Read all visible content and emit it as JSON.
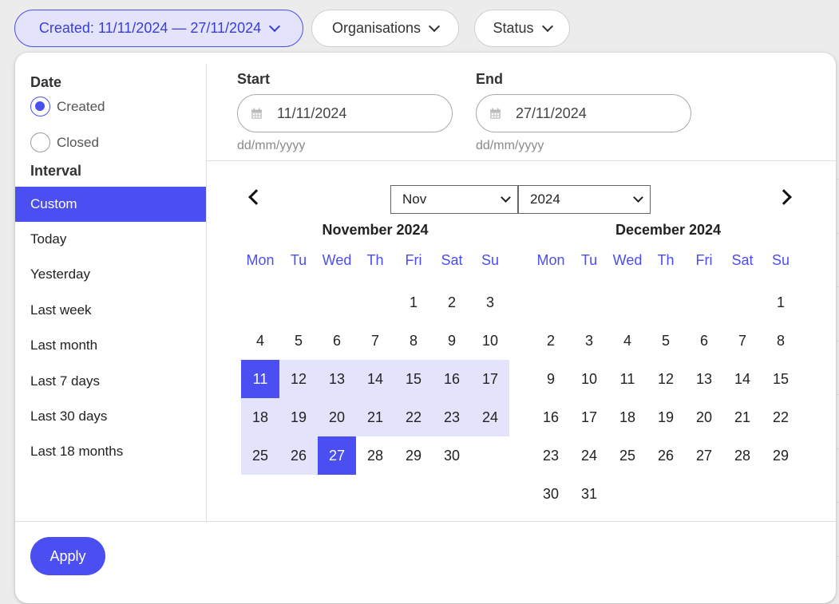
{
  "filters": {
    "created_chip": "Created: 11/11/2024 — 27/11/2024",
    "organisations_chip": "Organisations",
    "status_chip": "Status"
  },
  "date_type": {
    "heading": "Date",
    "options": [
      "Created",
      "Closed"
    ],
    "selected": "Created"
  },
  "interval": {
    "heading": "Interval",
    "items": [
      "Custom",
      "Today",
      "Yesterday",
      "Last week",
      "Last month",
      "Last 7 days",
      "Last 30 days",
      "Last 18 months"
    ],
    "selected": "Custom"
  },
  "start": {
    "label": "Start",
    "value": "11/11/2024",
    "hint": "dd/mm/yyyy"
  },
  "end": {
    "label": "End",
    "value": "27/11/2024",
    "hint": "dd/mm/yyyy"
  },
  "nav": {
    "month_select": "Nov",
    "year_select": "2024"
  },
  "weekdays": [
    "Mon",
    "Tu",
    "Wed",
    "Th",
    "Fri",
    "Sat",
    "Su"
  ],
  "calendars": [
    {
      "title": "November 2024",
      "weeks": [
        [
          "",
          "",
          "",
          "",
          "1",
          "2",
          "3"
        ],
        [
          "4",
          "5",
          "6",
          "7",
          "8",
          "9",
          "10"
        ],
        [
          "11",
          "12",
          "13",
          "14",
          "15",
          "16",
          "17"
        ],
        [
          "18",
          "19",
          "20",
          "21",
          "22",
          "23",
          "24"
        ],
        [
          "25",
          "26",
          "27",
          "28",
          "29",
          "30",
          ""
        ]
      ]
    },
    {
      "title": "December 2024",
      "weeks": [
        [
          "",
          "",
          "",
          "",
          "",
          "",
          "1"
        ],
        [
          "2",
          "3",
          "4",
          "5",
          "6",
          "7",
          "8"
        ],
        [
          "9",
          "10",
          "11",
          "12",
          "13",
          "14",
          "15"
        ],
        [
          "16",
          "17",
          "18",
          "19",
          "20",
          "21",
          "22"
        ],
        [
          "23",
          "24",
          "25",
          "26",
          "27",
          "28",
          "29"
        ],
        [
          "30",
          "31",
          "",
          "",
          "",
          "",
          ""
        ]
      ]
    }
  ],
  "range": {
    "start_day": "11",
    "end_day": "27"
  },
  "apply_label": "Apply",
  "colors": {
    "accent": "#4b4ef0",
    "range_fill": "#e3e3fb"
  }
}
